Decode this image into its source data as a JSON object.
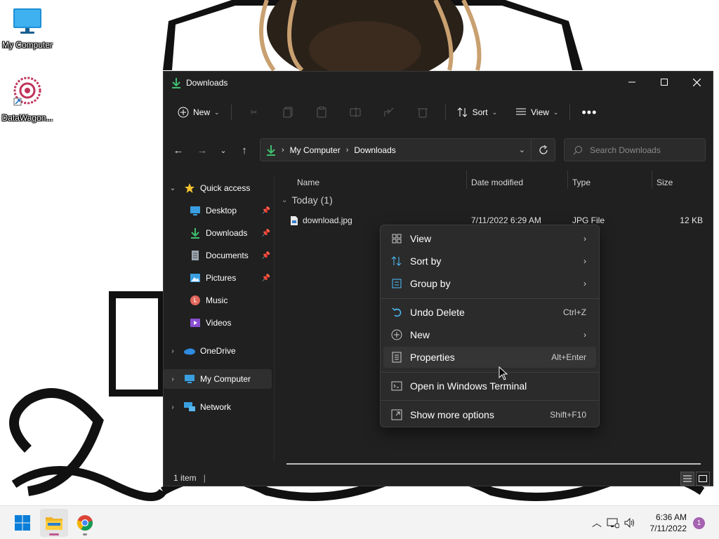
{
  "desktop": {
    "icons": [
      {
        "label": "My Computer"
      },
      {
        "label": "DataWagon..."
      }
    ]
  },
  "window": {
    "title": "Downloads",
    "toolbar": {
      "new_label": "New",
      "sort_label": "Sort",
      "view_label": "View"
    },
    "address": {
      "crumbs": [
        "My Computer",
        "Downloads"
      ]
    },
    "search": {
      "placeholder": "Search Downloads"
    },
    "sidebar": {
      "quick_access": "Quick access",
      "items": [
        {
          "label": "Desktop",
          "icon": "desktop-icon",
          "pinned": true
        },
        {
          "label": "Downloads",
          "icon": "download-icon",
          "pinned": true
        },
        {
          "label": "Documents",
          "icon": "document-icon",
          "pinned": true
        },
        {
          "label": "Pictures",
          "icon": "pictures-icon",
          "pinned": true
        },
        {
          "label": "Music",
          "icon": "music-icon",
          "pinned": false
        },
        {
          "label": "Videos",
          "icon": "videos-icon",
          "pinned": false
        }
      ],
      "onedrive": "OneDrive",
      "my_computer": "My Computer",
      "network": "Network"
    },
    "columns": {
      "name": "Name",
      "date": "Date modified",
      "type": "Type",
      "size": "Size"
    },
    "group": "Today (1)",
    "files": [
      {
        "name": "download.jpg",
        "date": "7/11/2022 6:29 AM",
        "type": "JPG File",
        "size": "12 KB"
      }
    ],
    "status": "1 item"
  },
  "context_menu": {
    "items": [
      {
        "label": "View",
        "icon": "view-grid-icon",
        "submenu": true
      },
      {
        "label": "Sort by",
        "icon": "sort-icon",
        "submenu": true
      },
      {
        "label": "Group by",
        "icon": "group-by-icon",
        "submenu": true
      },
      {
        "label": "Undo Delete",
        "icon": "undo-icon",
        "shortcut": "Ctrl+Z"
      },
      {
        "label": "New",
        "icon": "new-plus-icon",
        "submenu": true
      },
      {
        "label": "Properties",
        "icon": "properties-icon",
        "shortcut": "Alt+Enter"
      },
      {
        "label": "Open in Windows Terminal",
        "icon": "terminal-icon"
      },
      {
        "label": "Show more options",
        "icon": "more-options-icon",
        "shortcut": "Shift+F10"
      }
    ]
  },
  "taskbar": {
    "time": "6:36 AM",
    "date": "7/11/2022",
    "notifications": "1"
  },
  "colors": {
    "window_bg": "#202020",
    "menu_bg": "#2b2b2b",
    "accent": "#4cc2ff",
    "download_green": "#3fbf6f"
  }
}
